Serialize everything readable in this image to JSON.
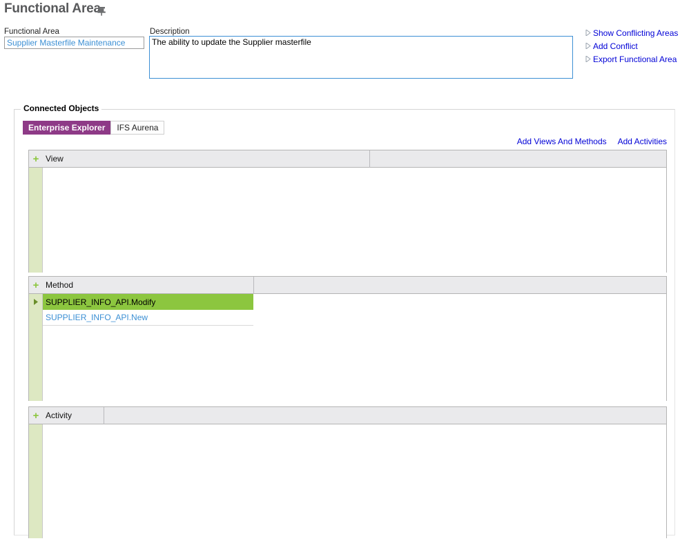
{
  "header": {
    "title": "Functional Area",
    "pin_icon": "pushpin-icon"
  },
  "form": {
    "functional_area": {
      "label": "Functional Area",
      "value": "Supplier Masterfile Maintenance",
      "placeholder": ""
    },
    "description": {
      "label": "Description",
      "value": "The ability to update the Supplier masterfile",
      "placeholder": ""
    }
  },
  "action_links": [
    {
      "label": "Show Conflicting Areas",
      "icon": "triangle-right-icon"
    },
    {
      "label": "Add Conflict",
      "icon": "triangle-right-icon"
    },
    {
      "label": "Export Functional Area",
      "icon": "triangle-right-icon"
    }
  ],
  "connected_objects": {
    "legend": "Connected Objects",
    "tabs": [
      {
        "label": "Enterprise Explorer",
        "active": true
      },
      {
        "label": "IFS Aurena",
        "active": false
      }
    ],
    "toolbar_links": [
      {
        "label": "Add Views And Methods"
      },
      {
        "label": "Add Activities"
      }
    ],
    "grids": [
      {
        "name": "view",
        "header": "View",
        "add_icon": "plus-icon",
        "rows": []
      },
      {
        "name": "method",
        "header": "Method",
        "add_icon": "plus-icon",
        "rows": [
          {
            "label": "SUPPLIER_INFO_API.Modify",
            "selected": true,
            "marker": "triangle-right-icon"
          },
          {
            "label": "SUPPLIER_INFO_API.New",
            "selected": false,
            "marker": ""
          }
        ]
      },
      {
        "name": "activity",
        "header": "Activity",
        "add_icon": "plus-icon",
        "rows": []
      }
    ]
  },
  "colors": {
    "tab_active_bg": "#8e3a87",
    "selected_row_bg": "#8cc63f",
    "gutter_bg": "#dde8c2",
    "link_blue": "#0000d6",
    "value_blue": "#3b8fd4",
    "title_gray": "#58595b",
    "header_gray": "#eaeaec"
  }
}
